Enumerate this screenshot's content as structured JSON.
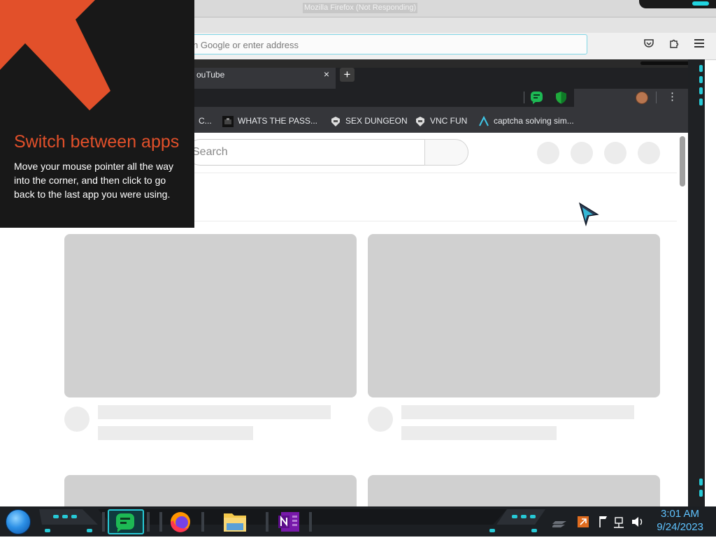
{
  "firefox": {
    "title": "Mozilla Firefox (Not Responding)",
    "url_placeholder": "h Google or enter address"
  },
  "chrome": {
    "tab_title": "ouTube",
    "tab_close": "×",
    "new_tab": "+",
    "menu": "⋮",
    "bookmarks": [
      {
        "label": "C..."
      },
      {
        "label": "WHATS THE PASS..."
      },
      {
        "label": "SEX DUNGEON"
      },
      {
        "label": "VNC FUN"
      },
      {
        "label": "captcha solving sim..."
      }
    ]
  },
  "youtube": {
    "search_placeholder": "Search"
  },
  "switch_tooltip": {
    "title": "Switch between apps",
    "body": "Move your mouse pointer all the way into the corner, and then click to go back to the last app you were using."
  },
  "taskbar": {
    "apps": [
      "chat-app",
      "firefox",
      "file-explorer",
      "onenote"
    ],
    "clock_time": "3:01 AM",
    "clock_date": "9/24/2023"
  },
  "colors": {
    "accent_cyan": "#27c9d6",
    "switch_orange": "#e2502a",
    "clock_blue": "#5fc3ff",
    "skeleton_gray": "#d0d0d0"
  }
}
